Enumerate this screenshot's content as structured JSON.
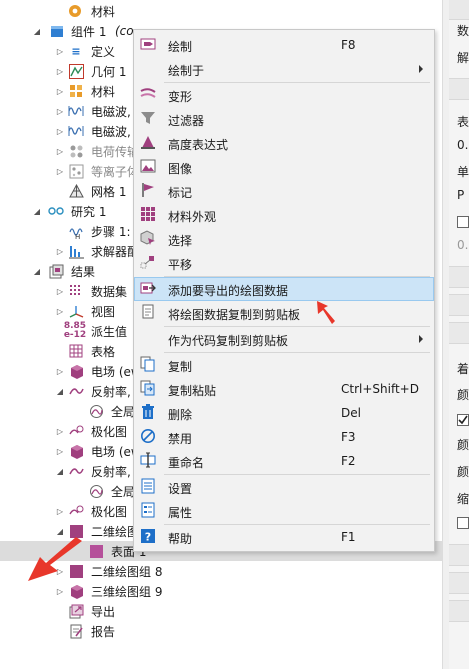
{
  "tree": {
    "items": [
      {
        "label": "材料",
        "suffix": "",
        "icon": "materials-icon",
        "dim": false
      },
      {
        "label": "组件 1",
        "suffix": "(co",
        "icon": "component-icon",
        "dim": false
      },
      {
        "label": "定义",
        "suffix": "",
        "icon": "definitions-icon",
        "dim": false
      },
      {
        "label": "几何 1",
        "suffix": "",
        "icon": "geometry-icon",
        "dim": false
      },
      {
        "label": "材料",
        "suffix": "",
        "icon": "materials-icon",
        "dim": false
      },
      {
        "label": "电磁波,",
        "suffix": "",
        "icon": "em-waves-icon",
        "dim": false
      },
      {
        "label": "电磁波,",
        "suffix": "",
        "icon": "em-waves-icon",
        "dim": false
      },
      {
        "label": "电荷传输",
        "suffix": "",
        "icon": "charge-transport-icon",
        "dim": true
      },
      {
        "label": "等离子体",
        "suffix": "",
        "icon": "plasma-icon",
        "dim": true
      },
      {
        "label": "网格 1",
        "suffix": "",
        "icon": "mesh-icon",
        "dim": false
      },
      {
        "label": "研究 1",
        "suffix": "",
        "icon": "study-icon",
        "dim": false
      },
      {
        "label": "步骤 1:",
        "suffix": "",
        "icon": "study-step-icon",
        "dim": false
      },
      {
        "label": "求解器配",
        "suffix": "",
        "icon": "solver-icon",
        "dim": false
      },
      {
        "label": "结果",
        "suffix": "",
        "icon": "results-icon",
        "dim": false
      },
      {
        "label": "数据集",
        "suffix": "",
        "icon": "datasets-icon",
        "dim": false
      },
      {
        "label": "视图",
        "suffix": "",
        "icon": "views-icon",
        "dim": false
      },
      {
        "label": "派生值",
        "suffix": "",
        "icon": "derived-values-icon",
        "dim": false
      },
      {
        "label": "表格",
        "suffix": "",
        "icon": "tables-icon",
        "dim": false
      },
      {
        "label": "电场 (ew",
        "suffix": "",
        "icon": "plot-group-3d-icon",
        "dim": false
      },
      {
        "label": "反射率,",
        "suffix": "",
        "icon": "1d-plot-icon",
        "dim": false
      },
      {
        "label": "全局",
        "suffix": "",
        "icon": "global-icon",
        "dim": false
      },
      {
        "label": "极化图",
        "suffix": "",
        "icon": "polarization-plot-icon",
        "dim": false
      },
      {
        "label": "电场 (ew",
        "suffix": "",
        "icon": "plot-group-3d-icon",
        "dim": false
      },
      {
        "label": "反射率,",
        "suffix": "",
        "icon": "1d-plot-icon",
        "dim": false
      },
      {
        "label": "全局",
        "suffix": "",
        "icon": "global-icon",
        "dim": false
      },
      {
        "label": "极化图",
        "suffix": "",
        "icon": "polarization-plot-icon",
        "dim": false
      },
      {
        "label": "二维绘图",
        "suffix": "",
        "icon": "2d-plot-group-icon",
        "dim": false
      },
      {
        "label": "表面 1",
        "suffix": "",
        "icon": "surface-plot-icon",
        "dim": false
      },
      {
        "label": "二维绘图组 8",
        "suffix": "",
        "icon": "2d-plot-group-icon",
        "dim": false
      },
      {
        "label": "三维绘图组 9",
        "suffix": "",
        "icon": "3d-plot-group-icon",
        "dim": false
      },
      {
        "label": "导出",
        "suffix": "",
        "icon": "export-icon",
        "dim": false
      },
      {
        "label": "报告",
        "suffix": "",
        "icon": "report-icon",
        "dim": false
      }
    ]
  },
  "menu": {
    "items": [
      {
        "label": "绘制",
        "shortcut": "F8",
        "icon": "plot-icon",
        "submenu": false
      },
      {
        "label": "绘制于",
        "shortcut": "",
        "icon": "",
        "submenu": true
      },
      {
        "label": "变形",
        "shortcut": "",
        "icon": "deformation-icon",
        "submenu": false
      },
      {
        "label": "过滤器",
        "shortcut": "",
        "icon": "filter-icon",
        "submenu": false
      },
      {
        "label": "高度表达式",
        "shortcut": "",
        "icon": "height-expression-icon",
        "submenu": false
      },
      {
        "label": "图像",
        "shortcut": "",
        "icon": "image-icon",
        "submenu": false
      },
      {
        "label": "标记",
        "shortcut": "",
        "icon": "marker-icon",
        "submenu": false
      },
      {
        "label": "材料外观",
        "shortcut": "",
        "icon": "material-appearance-icon",
        "submenu": false
      },
      {
        "label": "选择",
        "shortcut": "",
        "icon": "selection-icon",
        "submenu": false
      },
      {
        "label": "平移",
        "shortcut": "",
        "icon": "translation-icon",
        "submenu": false
      },
      {
        "label": "添加要导出的绘图数据",
        "shortcut": "",
        "icon": "add-plot-data-export-icon",
        "submenu": false
      },
      {
        "label": "将绘图数据复制到剪贴板",
        "shortcut": "",
        "icon": "copy-plot-data-icon",
        "submenu": false
      },
      {
        "label": "作为代码复制到剪贴板",
        "shortcut": "",
        "icon": "",
        "submenu": true
      },
      {
        "label": "复制",
        "shortcut": "",
        "icon": "copy-icon",
        "submenu": false
      },
      {
        "label": "复制粘贴",
        "shortcut": "Ctrl+Shift+D",
        "icon": "duplicate-icon",
        "submenu": false
      },
      {
        "label": "删除",
        "shortcut": "Del",
        "icon": "delete-icon",
        "submenu": false
      },
      {
        "label": "禁用",
        "shortcut": "F3",
        "icon": "disable-icon",
        "submenu": false
      },
      {
        "label": "重命名",
        "shortcut": "F2",
        "icon": "rename-icon",
        "submenu": false
      },
      {
        "label": "设置",
        "shortcut": "",
        "icon": "settings-icon",
        "submenu": false
      },
      {
        "label": "属性",
        "shortcut": "",
        "icon": "properties-icon",
        "submenu": false
      },
      {
        "label": "帮助",
        "shortcut": "F1",
        "icon": "help-icon",
        "submenu": false
      }
    ]
  },
  "right_panel": {
    "texts": [
      "数",
      "解",
      "表",
      "0.",
      "单",
      "P",
      "0.",
      "着",
      "颜",
      "颜",
      "颜",
      "缩"
    ]
  },
  "colors": {
    "highlight": "#cce4f7",
    "plot_magenta": "#a0407f",
    "annotation_red": "#e8372b",
    "comsol_blue": "#1e6fc8"
  }
}
